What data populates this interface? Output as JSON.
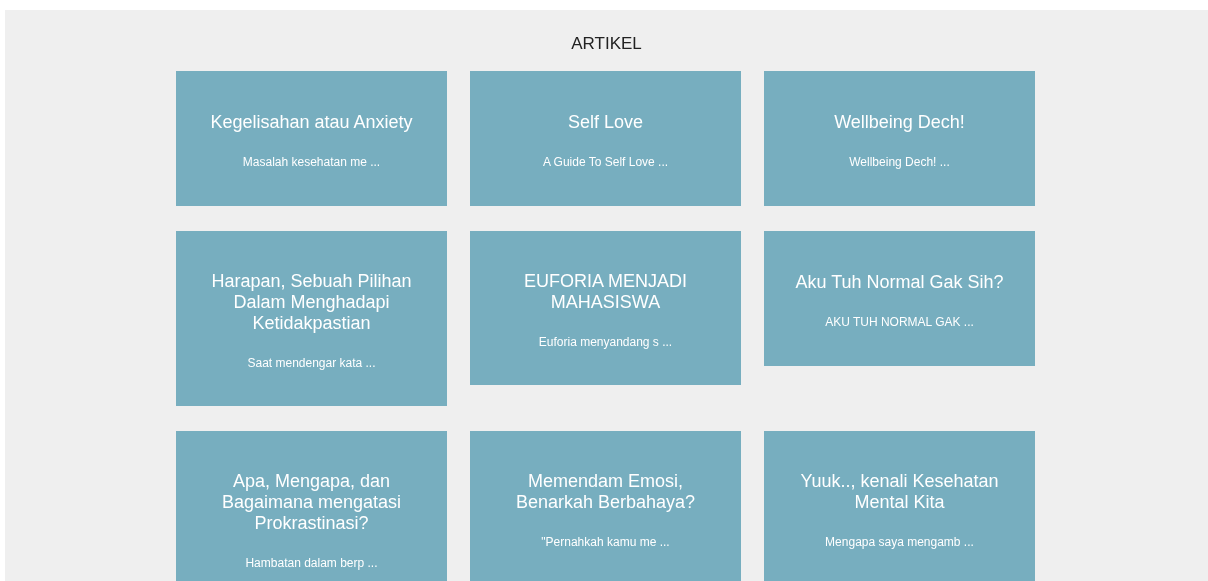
{
  "heading": "ARTIKEL",
  "articles": [
    {
      "title": "Kegelisahan atau Anxiety",
      "excerpt": "Masalah kesehatan me ..."
    },
    {
      "title": "Self Love",
      "excerpt": "A Guide To Self Love ..."
    },
    {
      "title": "Wellbeing Dech!",
      "excerpt": "Wellbeing Dech! ..."
    },
    {
      "title": "Harapan, Sebuah Pilihan Dalam Menghadapi Ketidakpastian",
      "excerpt": "Saat mendengar kata ..."
    },
    {
      "title": "EUFORIA MENJADI MAHASISWA",
      "excerpt": "Euforia menyandang s ..."
    },
    {
      "title": "Aku Tuh Normal Gak Sih?",
      "excerpt": "AKU TUH NORMAL GAK ..."
    },
    {
      "title": "Apa, Mengapa, dan Bagaimana mengatasi Prokrastinasi?",
      "excerpt": "Hambatan dalam berp ..."
    },
    {
      "title": "Memendam Emosi, Benarkah Berbahaya?",
      "excerpt": "\"Pernahkah kamu me ..."
    },
    {
      "title": "Yuuk.., kenali Kesehatan Mental Kita",
      "excerpt": "Mengapa saya mengamb ..."
    }
  ]
}
